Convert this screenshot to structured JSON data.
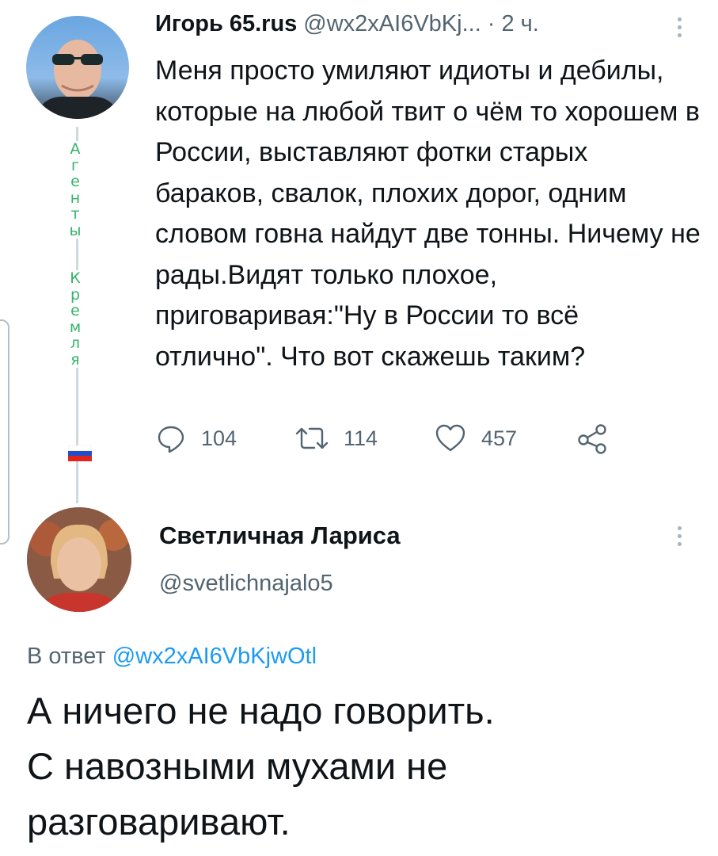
{
  "tweet1": {
    "author_name": "Игорь 65.rus",
    "author_handle": "@wx2xAI6VbKj...",
    "time": "· 2 ч.",
    "text": "Меня просто умиляют идиоты и дебилы, которые на любой твит о чём то хорошем в России, выставляют фотки старых бараков, свалок, плохих дорог, одним словом говна найдут две тонны. Ничему не рады.Видят только плохое, приговаривая:\"Ну в России то всё отлично\". Что вот скажешь таким?",
    "side_letters": [
      "А",
      "г",
      "е",
      "н",
      "т",
      "ы",
      "",
      "К",
      "р",
      "е",
      "м",
      "л",
      "я"
    ],
    "actions": {
      "replies": "104",
      "retweets": "114",
      "likes": "457"
    },
    "flag_icon": "russia-flag-icon"
  },
  "tweet2": {
    "author_name": "Светличная Лариса",
    "author_handle": "@svetlichnajalo5",
    "reply_prefix": "В ответ",
    "reply_mention": "@wx2xAI6VbKjwOtl",
    "text_lines": [
      "А ничего не надо говорить.",
      "С навозными мухами не",
      "разговаривают."
    ]
  },
  "colors": {
    "text": "#0f1419",
    "muted": "#536471",
    "link": "#1d9bf0",
    "side_letters": "#33b36a"
  }
}
